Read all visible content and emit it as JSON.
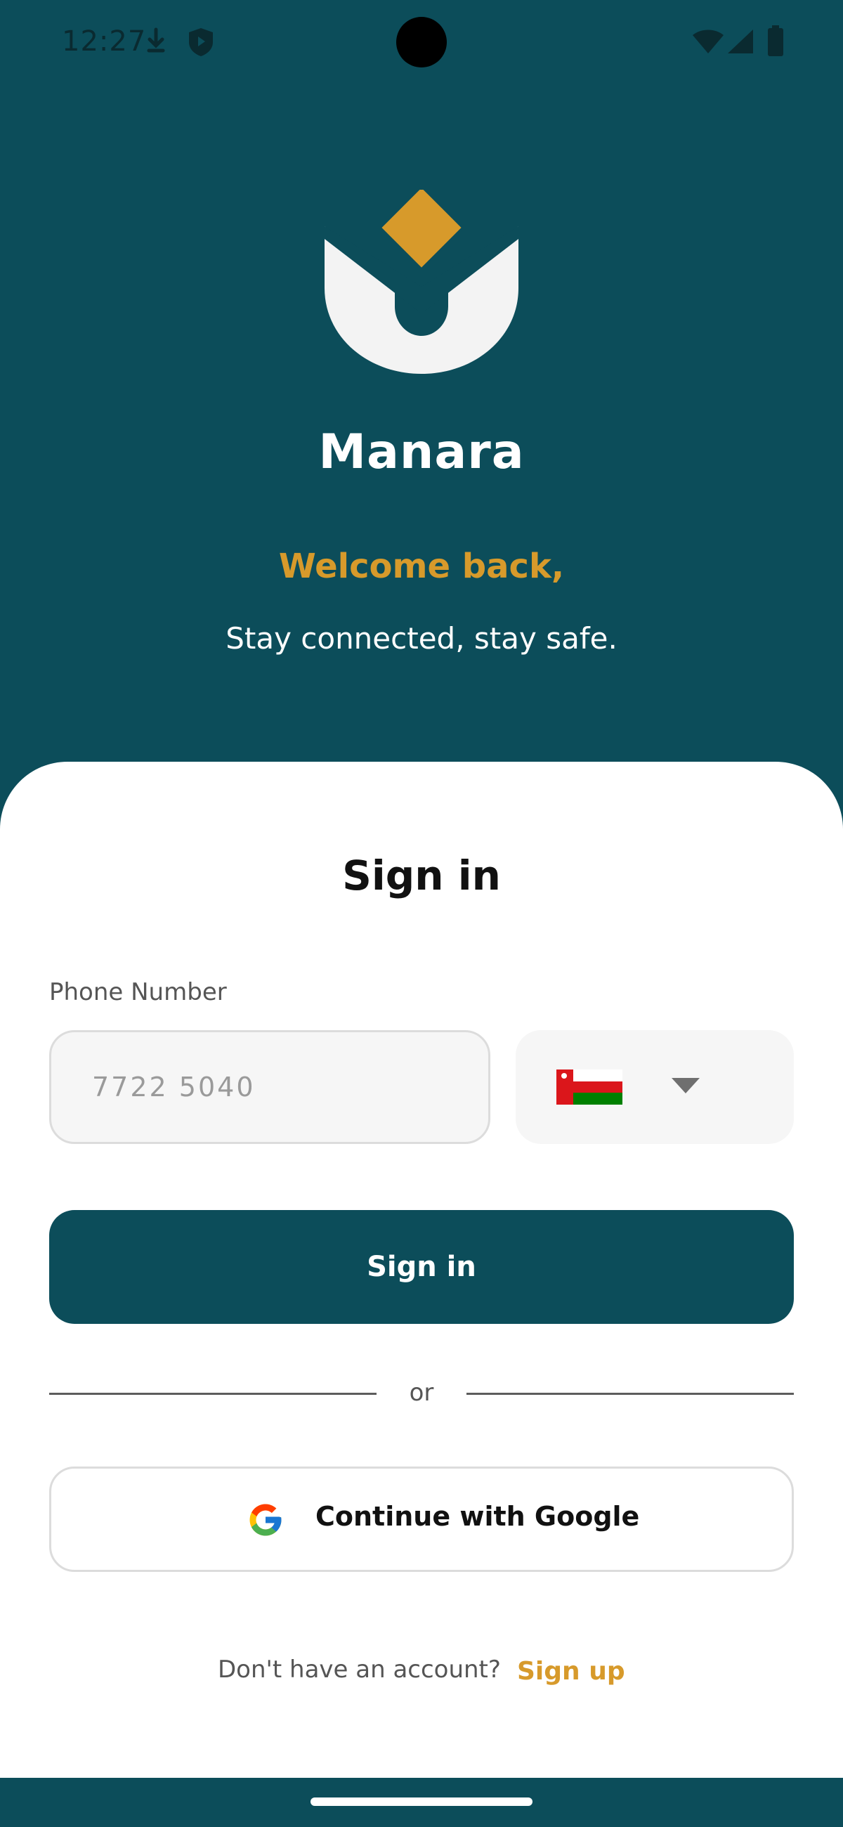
{
  "status_bar": {
    "time": "12:27",
    "icons": [
      "download-icon",
      "shield-icon",
      "wifi-icon",
      "signal-icon",
      "battery-icon"
    ]
  },
  "hero": {
    "brand_name": "Manara",
    "welcome": "Welcome back,",
    "tagline": "Stay connected, stay safe.",
    "colors": {
      "background": "#0c4d5a",
      "accent": "#d79a2b"
    }
  },
  "form": {
    "title": "Sign in",
    "phone_label": "Phone Number",
    "phone_placeholder": "7722 5040",
    "country_flag": "oman-flag",
    "submit_label": "Sign in",
    "divider_text": "or",
    "google_label": "Continue with Google",
    "signup_prompt": "Don't have an account?",
    "signup_link": "Sign up"
  }
}
